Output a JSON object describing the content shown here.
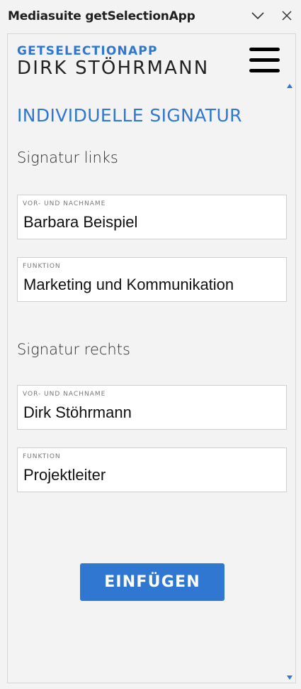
{
  "window": {
    "title": "Mediasuite getSelectionApp",
    "collapse_icon": "chevron-down-icon",
    "close_icon": "close-icon"
  },
  "header": {
    "brand_top": "GETSELECTIONAPP",
    "brand_bottom": "DIRK STÖHRMANN",
    "menu_icon": "hamburger-menu-icon"
  },
  "page": {
    "heading": "INDIVIDUELLE SIGNATUR"
  },
  "signature_left": {
    "section_title": "Signatur links",
    "name_label": "VOR- UND NACHNAME",
    "name_value": "Barbara Beispiel",
    "function_label": "FUNKTION",
    "function_value": "Marketing und Kommunikation"
  },
  "signature_right": {
    "section_title": "Signatur rechts",
    "name_label": "VOR- UND NACHNAME",
    "name_value": "Dirk Stöhrmann",
    "function_label": "FUNKTION",
    "function_value": "Projektleiter"
  },
  "actions": {
    "insert_label": "EINFÜGEN"
  },
  "colors": {
    "accent": "#2f77d0",
    "background": "#f3f3f3"
  }
}
